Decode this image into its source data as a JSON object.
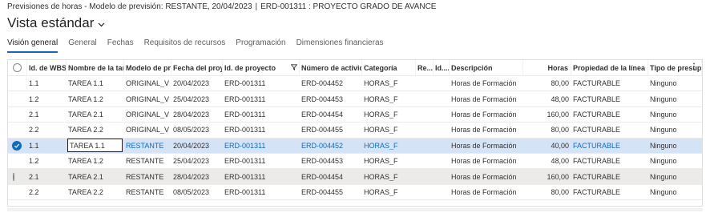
{
  "header": {
    "caption_left": "Previsiones de horas - Modelo de previsión: RESTANTE, 20/04/2023",
    "separator": "|",
    "caption_right": "ERD-001311 : PROYECTO GRADO DE AVANCE",
    "view_title": "Vista estándar"
  },
  "tabs": [
    "Visión general",
    "General",
    "Fechas",
    "Requisitos de recursos",
    "Programación",
    "Dimensiones financieras"
  ],
  "grid": {
    "columns": [
      "Id. de WBS",
      "Nombre de la tarea",
      "Modelo de pre...",
      "Fecha del proye...",
      "Id. de proyecto",
      "Número de actividad",
      "Categoría",
      "Re...",
      "Id....",
      "Descripción",
      "Horas",
      "Propiedad de la línea",
      "Tipo de presupue"
    ],
    "rows": [
      {
        "wbs": "1.1",
        "task": "TAREA 1.1",
        "model": "ORIGINAL_V",
        "date": "20/04/2023",
        "project": "ERD-001311",
        "activity": "ERD-004452",
        "category": "HORAS_F",
        "re": "",
        "id": "",
        "description": "Horas de Formación",
        "hours": "80,00",
        "property": "FACTURABLE",
        "budget": "Ninguno"
      },
      {
        "wbs": "1.2",
        "task": "TAREA 1.2",
        "model": "ORIGINAL_V",
        "date": "25/04/2023",
        "project": "ERD-001311",
        "activity": "ERD-004453",
        "category": "HORAS_F",
        "re": "",
        "id": "",
        "description": "Horas de Formación",
        "hours": "48,00",
        "property": "FACTURABLE",
        "budget": "Ninguno"
      },
      {
        "wbs": "2.1",
        "task": "TAREA 2.1",
        "model": "ORIGINAL_V",
        "date": "28/04/2023",
        "project": "ERD-001311",
        "activity": "ERD-004454",
        "category": "HORAS_F",
        "re": "",
        "id": "",
        "description": "Horas de Formación",
        "hours": "160,00",
        "property": "FACTURABLE",
        "budget": "Ninguno"
      },
      {
        "wbs": "2.2",
        "task": "TAREA 2.2",
        "model": "ORIGINAL_V",
        "date": "08/05/2023",
        "project": "ERD-001311",
        "activity": "ERD-004455",
        "category": "HORAS_F",
        "re": "",
        "id": "",
        "description": "Horas de Formación",
        "hours": "80,00",
        "property": "FACTURABLE",
        "budget": "Ninguno"
      },
      {
        "wbs": "1.1",
        "task": "TAREA 1.1",
        "model": "RESTANTE",
        "date": "20/04/2023",
        "project": "ERD-001311",
        "activity": "ERD-004452",
        "category": "HORAS_F",
        "re": "",
        "id": "",
        "description": "Horas de Formación",
        "hours": "40,00",
        "property": "FACTURABLE",
        "budget": "Ninguno"
      },
      {
        "wbs": "1.2",
        "task": "TAREA 1.2",
        "model": "RESTANTE",
        "date": "25/04/2023",
        "project": "ERD-001311",
        "activity": "ERD-004453",
        "category": "HORAS_F",
        "re": "",
        "id": "",
        "description": "Horas de Formación",
        "hours": "48,00",
        "property": "FACTURABLE",
        "budget": "Ninguno"
      },
      {
        "wbs": "2.1",
        "task": "TAREA 2.1",
        "model": "RESTANTE",
        "date": "28/04/2023",
        "project": "ERD-001311",
        "activity": "ERD-004454",
        "category": "HORAS_F",
        "re": "",
        "id": "",
        "description": "Horas de Formación",
        "hours": "160,00",
        "property": "FACTURABLE",
        "budget": "Ninguno"
      },
      {
        "wbs": "2.2",
        "task": "TAREA 2.2",
        "model": "RESTANTE",
        "date": "08/05/2023",
        "project": "ERD-001311",
        "activity": "ERD-004455",
        "category": "HORAS_F",
        "re": "",
        "id": "",
        "description": "Horas de Formación",
        "hours": "80,00",
        "property": "FACTURABLE",
        "budget": "Ninguno"
      }
    ],
    "selected_row": 4,
    "hover_row": 6
  },
  "colors": {
    "accent": "#0f6cbd",
    "selected_row": "#d5e3f7",
    "hover_row": "#edebe9"
  },
  "icons": {
    "title_dropdown": "chevron-down-icon",
    "filter": "filter-icon",
    "more": "more-options-icon",
    "row_selected": "checkmark-circle-icon"
  }
}
